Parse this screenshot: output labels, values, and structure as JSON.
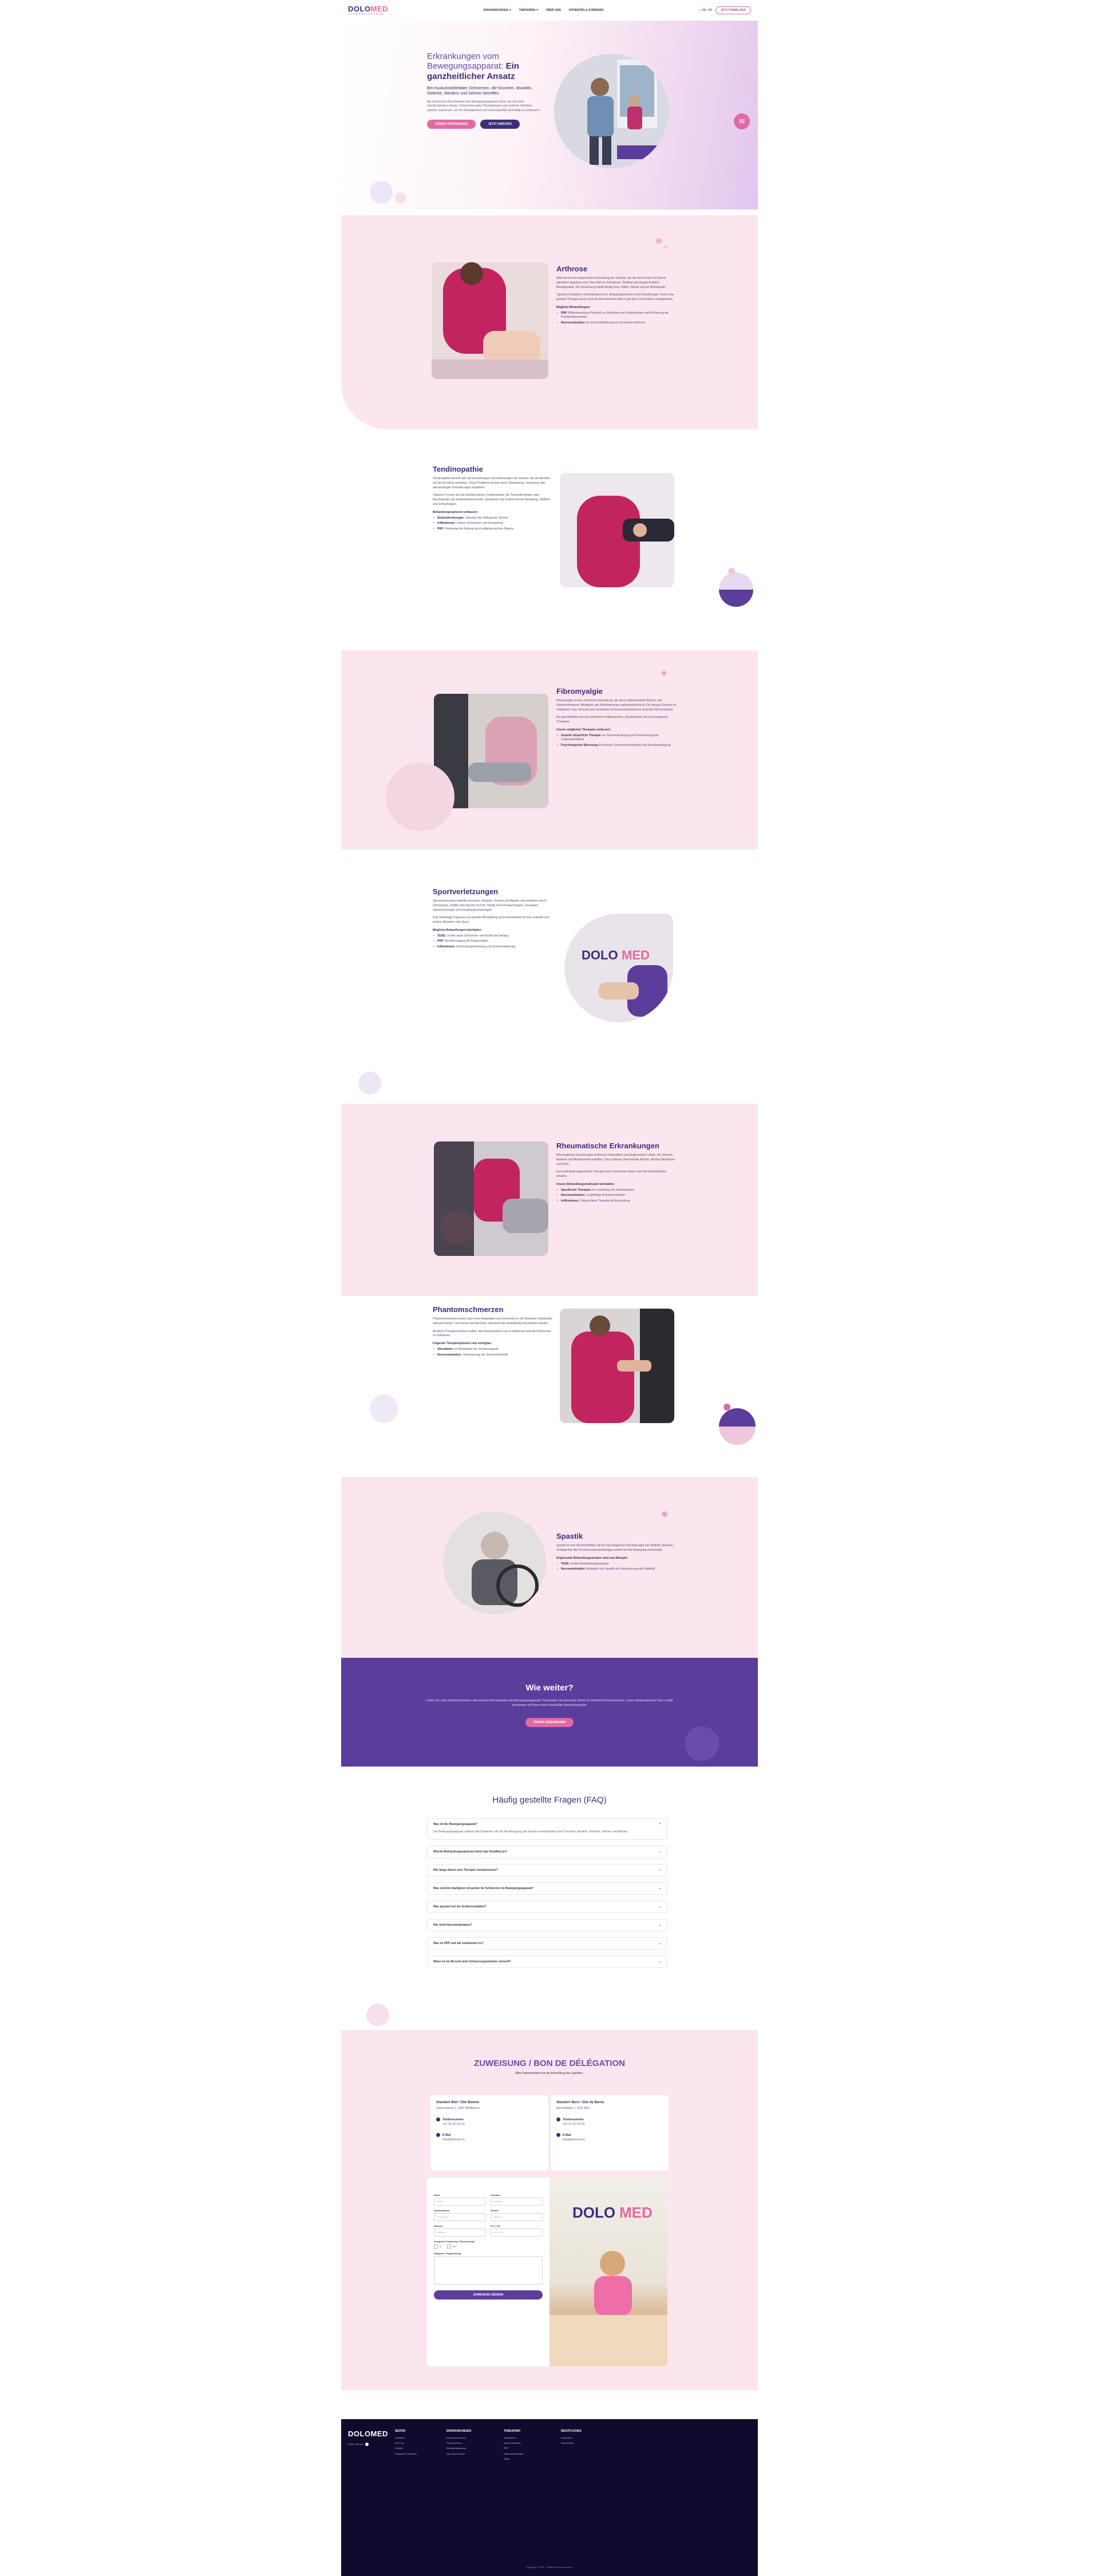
{
  "header": {
    "logo": {
      "part1": "DOLO",
      "part2": "MED",
      "subtitle": "SCHMERZZENTRUM"
    },
    "nav": [
      {
        "label": "ERKRANKUNGEN"
      },
      {
        "label": "THERAPIEN"
      },
      {
        "label": "ÜBER UNS"
      },
      {
        "label": "PATIENTEN & ZUWEISER"
      }
    ],
    "lang": "DE / FR",
    "cta": "JETZT ANMELDEN"
  },
  "hero": {
    "title_light": "Erkrankungen vom Bewegungsapparat:",
    "title_bold": "Ein ganzheitlicher Ansatz",
    "lead": "Bei muskuloskelettalen Schmerzen, die Knochen, Muskeln, Gelenke, Bändern und Sehnen betreffen.",
    "body": "Bei chronischen Beschwerden des Bewegungsapparats setzen wir auf einen interdisziplinären Ansatz: Schmerztherapie, Physiotherapie und moderne Verfahren arbeiten zusammen, um Ihre Beweglichkeit und Lebensqualität nachhaltig zu verbessern.",
    "btn_primary": "TERMIN VEREINBAREN",
    "btn_secondary": "JETZT ANRUFEN",
    "chat_icon": "chat-bubble-icon"
  },
  "sections": [
    {
      "title": "Arthrose",
      "p1": "Arthrose ist eine degenerative Erkrankung der Gelenke, bei der der Knorpel im Gelenk allmählich abgebaut wird. Dies führt zu Schmerzen, Steifheit und eingeschränkter Beweglichkeit. Die Erkrankung betrifft häufig Knie, Hüften, Hände und die Wirbelsäule.",
      "p2": "Typische Symptome sind Anlaufschmerz, Belastungsschmerz und Schwellungen. Durch eine gezielte Therapie lassen sich die Beschwerden lindern und das Fortschreiten verlangsamen.",
      "bold": "Mögliche Behandlungen:",
      "items": [
        {
          "b": "PRP",
          "t": "(Plättchenreiches Plasma) zur Reduktion von Entzündungen und Förderung der Knorpelregeneration"
        },
        {
          "b": "Neuromodulation",
          "t": "zur Schmerzlinderung bei chronischer Arthrose"
        }
      ]
    },
    {
      "title": "Tendinopathie",
      "p1": "Tendinopathie bezieht sich auf Erkrankungen und Verletzungen der Sehnen, die die Muskeln mit den Knochen verbinden. Diese Probleme können durch Überlastung, Verletzung oder altersbedingte Veränderungen entstehen.",
      "p2": "Typische Formen sind die Achillessehnen-Tendinopathie, der Tennisellenbogen oder Beschwerden der Rotatorenmanschette. Symptome sind Schmerzen bei Belastung, Steifheit und Schwellungen.",
      "bold": "Behandlungsoptionen umfassen:",
      "items": [
        {
          "b": "Stoßwellentherapie:",
          "t": "Stimuliert die Heilung der Sehnen"
        },
        {
          "b": "Infiltrationen:",
          "t": "Lindern Schmerzen und Entzündung"
        },
        {
          "b": "PRP:",
          "t": "Förderung der Heilung durch plättchenreiches Plasma"
        }
      ]
    },
    {
      "title": "Fibromyalgie",
      "p1": "Fibromyalgie ist eine chronische Erkrankung, die durch weitverbreitete Muskel- und Gelenkschmerzen, Müdigkeit und Schlafstörungen gekennzeichnet ist. Die genaue Ursache ist unbekannt, man vermutet eine veränderte Schmerzverarbeitung im zentralen Nervensystem.",
      "p2": "Ein ganzheitlicher Ansatz kombiniert medikamentöse, physikalische und psychologische Therapien.",
      "bold": "Unsere möglichen Therapien umfassen:",
      "items": [
        {
          "b": "Gezielte körperliche Therapie",
          "t": "zur Schmerzlinderung und Verbesserung der Leistungsfähigkeit"
        },
        {
          "b": "Psychologische Betreuung",
          "t": "für bessere Schmerzverarbeitung und Stressbewältigung"
        }
      ]
    },
    {
      "title": "Sportverletzungen",
      "p1": "Sportverletzungen betreffen Knochen, Muskeln, Sehnen und Bänder und entstehen durch Überlastung, Unfälle oder falsche Technik. Häufig sind Verstauchungen, Zerrungen, Sehnenreizungen und Kreuzbandverletzungen.",
      "p2": "Eine frühzeitige Diagnose und gezielte Behandlung sind entscheidend für eine schnelle und sichere Rückkehr zum Sport.",
      "bold": "Mögliche Behandlungen beinhalten:",
      "items": [
        {
          "b": "TENS:",
          "t": "Lindert akute Schmerzen und fördert die Heilung"
        },
        {
          "b": "PRP:",
          "t": "Beschleunigung der Regeneration"
        },
        {
          "b": "Infiltrationen:",
          "t": "Entzündungshemmung und Schmerzlinderung"
        }
      ]
    },
    {
      "title": "Rheumatische Erkrankungen",
      "p1": "Rheumatische Erkrankungen umfassen entzündliche und degenerative Leiden, die Gelenke, Muskeln und Bindegewebe betreffen. Dazu gehören rheumatoide Arthritis, Morbus Bechterew und Gicht.",
      "p2": "Eine individuell abgestimmte Therapie kann Schmerzen lindern und die Gelenkfunktion erhalten.",
      "bold": "Unsere Behandlungsmethoden beinhalten:",
      "items": [
        {
          "b": "Spezifische Therapien",
          "t": "zur Linderung von Entzündungen"
        },
        {
          "b": "Neuromodulation:",
          "t": "Langfristige Schmerzreduktion"
        },
        {
          "b": "Infiltrationen:",
          "t": "Zielgerichtete Therapie bei Entzündung"
        }
      ]
    },
    {
      "title": "Phantomschmerzen",
      "p1": "Phantomschmerzen treten nach einer Amputation auf und werden in der fehlenden Gliedmaße wahrgenommen. Sie können als brennend, stechend oder krampfartig beschrieben werden.",
      "p2": "Moderne Therapieverfahren helfen, das Nervensystem neu zu kalibrieren und die Schmerzen zu reduzieren.",
      "bold": "Folgende Therapieoptionen sind verfügbar:",
      "items": [
        {
          "b": "Stimulation",
          "t": "zur Modulation der Schmerzsignale"
        },
        {
          "b": "Neuromodulation:",
          "t": "Verbesserung der Schmerzkontrolle"
        }
      ]
    },
    {
      "title": "Spastik",
      "p1": "Spastik ist eine Muskelsteifheit, die bei neurologischen Erkrankungen wie Multipler Sklerose, Schlaganfall oder Rückenmarksverletzungen auftritt und die Bewegung einschränkt.",
      "p2": "",
      "bold": "Ergänzende Behandlungsansätze sind zum Beispiel:",
      "items": [
        {
          "b": "TENS:",
          "t": "Lindert Muskelverspannungen"
        },
        {
          "b": "Neuromodulation:",
          "t": "Reduktion der Spastik und Verbesserung der Mobilität"
        }
      ]
    }
  ],
  "cta": {
    "title": "Wie weiter?",
    "text": "Leiden Sie unter Rückenschmerzen oder anderen Erkrankungen des Bewegungsapparats? Vereinbaren Sie jetzt einen Termin im DoloMed Schmerzzentrum. Unser interdisziplinäres Team erstellt gemeinsam mit Ihnen einen individuellen Behandlungsplan.",
    "btn": "TERMIN VEREINBAREN"
  },
  "faq": {
    "title": "Häufig gestellte Fragen (FAQ)",
    "items": [
      {
        "q": "Was ist der Bewegungsapparat?",
        "a": "Der Bewegungsapparat umfasst alle Strukturen, die für die Bewegung des Körpers verantwortlich sind: Knochen, Muskeln, Gelenke, Sehnen und Bänder.",
        "open": true
      },
      {
        "q": "Welche Behandlungsoptionen bietet das DoloMed an?",
        "a": "",
        "open": false
      },
      {
        "q": "Wie lange dauert eine Therapie normalerweise?",
        "a": "",
        "open": false
      },
      {
        "q": "Was sind die häufigsten Ursachen für Schmerzen im Bewegungsapparat?",
        "a": "",
        "open": false
      },
      {
        "q": "Was passiert bei der Erstkonsultation?",
        "a": "",
        "open": false
      },
      {
        "q": "Wie wirkt Neuromodulation?",
        "a": "",
        "open": false
      },
      {
        "q": "Was ist PRP und wie funktioniert es?",
        "a": "",
        "open": false
      },
      {
        "q": "Wann ist ein Besuch beim Schmerzspezialisten sinnvoll?",
        "a": "",
        "open": false
      }
    ]
  },
  "zuweisung": {
    "title": "ZUWEISUNG / BON DE DÉLÉGATION",
    "subtitle": "Bitte Patientendaten für die Anmeldung hier ausfüllen.",
    "locations": [
      {
        "name": "Standort Biel / Site Bienne",
        "addr": "Dufourstrasse 1, 2502 Biel/Bienne",
        "tel_label": "Telefonnummer",
        "tel": "+41 32 322 00 00",
        "mail_label": "E-Mail",
        "mail": "info@dolomed.ch"
      },
      {
        "name": "Standort Bern / Site de Berne",
        "addr": "Bahnhofplatz 1, 3011 Bern",
        "tel_label": "Telefonnummer",
        "tel": "+41 31 311 00 00",
        "mail_label": "E-Mail",
        "mail": "info@dolomed.ch"
      }
    ],
    "form": {
      "name_label": "Name",
      "name_ph": "Name",
      "vorname_label": "Vorname",
      "vorname_ph": "Vorname",
      "dob_label": "Geburtsdatum",
      "dob_ph": "TT.MM.JJJJ",
      "tel_label": "Telefon",
      "tel_ph": "Telefon",
      "adr_label": "Adresse",
      "adr_ph": "Adresse",
      "ort_label": "PLZ / Ort",
      "ort_ph": "PLZ / Ort",
      "chk_label": "Dringende Zuweisung / Überweisung:",
      "chk_a": "Ja",
      "chk_b": "Nein",
      "msg_label": "Diagnose / Fragestellung",
      "submit": "ZUWEISUNG SENDEN"
    }
  },
  "footer": {
    "logo": "DOLOMED",
    "follow": "Folgen Sie uns",
    "cols": [
      {
        "h": "SEITEN",
        "items": [
          "Startseite",
          "Über uns",
          "Kontakt",
          "Patienten & Zuweiser"
        ]
      },
      {
        "h": "ERKRANKUNGEN",
        "items": [
          "Rückenschmerzen",
          "Kopfschmerzen",
          "Bewegungsapparat",
          "Nervenschmerzen"
        ]
      },
      {
        "h": "THERAPIEN",
        "items": [
          "Infiltrationen",
          "Neuromodulation",
          "PRP",
          "Stoßwellentherapie",
          "TENS"
        ]
      },
      {
        "h": "RECHTLICHES",
        "items": [
          "Impressum",
          "Datenschutz"
        ]
      }
    ],
    "copyright": "Copyright © 2025 · DoloMed Schmerzzentrum"
  },
  "colors": {
    "brand_purple": "#3e2e7a",
    "brand_pink": "#e06aa4",
    "cta_bg": "#5b3d9c",
    "footer_bg": "#120a2e"
  }
}
